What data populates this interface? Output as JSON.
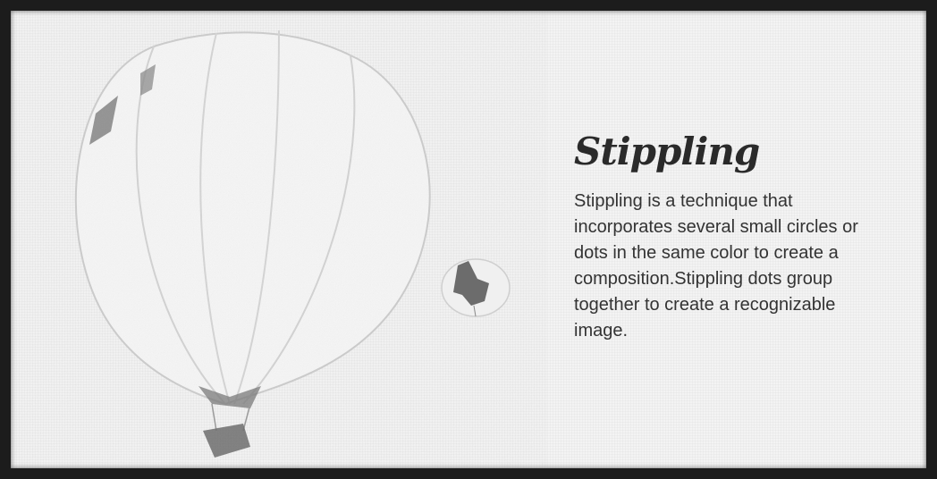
{
  "slide": {
    "title": "Stippling",
    "body": "Stippling is a technique that incorporates several small circles or dots in the same color to create a composition.Stippling dots group together to create a recognizable image."
  },
  "illustration": {
    "icon": "hot-air-balloon-stipple-drawing"
  },
  "colors": {
    "frame": "#1c1c1c",
    "paper": "#f3f3f3",
    "text": "#333333",
    "title": "#2a2a2a"
  }
}
